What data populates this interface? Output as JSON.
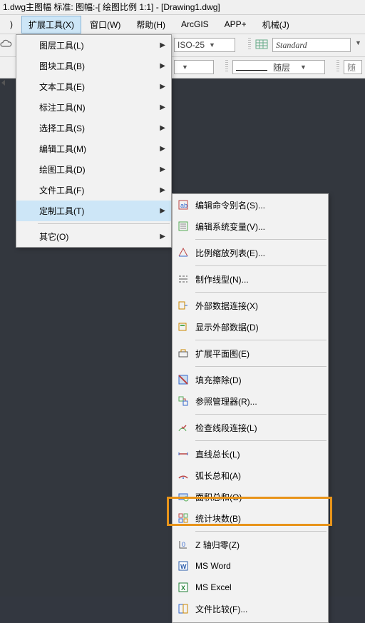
{
  "title": "1.dwg主图幅  标准: 图幅:-[ 绘图比例 1:1] - [Drawing1.dwg]",
  "menubar": {
    "partial0": ")",
    "ext_tools": "扩展工具(X)",
    "window": "窗口(W)",
    "help": "帮助(H)",
    "arcgis": "ArcGIS",
    "appplus": "APP+",
    "mech": "机械(J)"
  },
  "toolbar": {
    "dimstyle": "ISO-25",
    "textstyle": "Standard",
    "linetype": "随层",
    "linetype_right": "随"
  },
  "main_menu": {
    "items": [
      {
        "label": "图层工具(L)",
        "arrow": true
      },
      {
        "label": "图块工具(B)",
        "arrow": true
      },
      {
        "label": "文本工具(E)",
        "arrow": true
      },
      {
        "label": "标注工具(N)",
        "arrow": true
      },
      {
        "label": "选择工具(S)",
        "arrow": true
      },
      {
        "label": "编辑工具(M)",
        "arrow": true
      },
      {
        "label": "绘图工具(D)",
        "arrow": true
      },
      {
        "label": "文件工具(F)",
        "arrow": true
      },
      {
        "label": "定制工具(T)",
        "arrow": true,
        "expanded": true
      },
      {
        "label": "其它(O)",
        "arrow": true,
        "sep_before": true
      }
    ]
  },
  "sub_menu": {
    "items": [
      {
        "icon": "alias",
        "label": "编辑命令别名(S)..."
      },
      {
        "icon": "sysvar",
        "label": "编辑系统变量(V)..."
      },
      {
        "sep": true
      },
      {
        "icon": "scalelist",
        "label": "比例缩放列表(E)..."
      },
      {
        "sep": true
      },
      {
        "icon": "linetype",
        "label": "制作线型(N)..."
      },
      {
        "sep": true
      },
      {
        "icon": "extdata",
        "label": "外部数据连接(X)"
      },
      {
        "icon": "showext",
        "label": "显示外部数据(D)"
      },
      {
        "sep": true
      },
      {
        "icon": "flatten",
        "label": "扩展平面图(E)"
      },
      {
        "sep": true
      },
      {
        "icon": "filldel",
        "label": "填充擦除(D)"
      },
      {
        "icon": "refmgr",
        "label": "参照管理器(R)..."
      },
      {
        "sep": true
      },
      {
        "icon": "checkseg",
        "label": "检查线段连接(L)"
      },
      {
        "sep": true
      },
      {
        "icon": "linelen",
        "label": "直线总长(L)"
      },
      {
        "icon": "arclen",
        "label": "弧长总和(A)"
      },
      {
        "icon": "areatot",
        "label": "面积总和(O)"
      },
      {
        "icon": "statblk",
        "label": "统计块数(B)"
      },
      {
        "sep": true
      },
      {
        "icon": "zzero",
        "label": "Z 轴归零(Z)"
      },
      {
        "icon": "msword",
        "label": "MS Word"
      },
      {
        "icon": "msexcel",
        "label": "MS Excel"
      },
      {
        "icon": "filecmp",
        "label": "文件比较(F)..."
      }
    ]
  }
}
